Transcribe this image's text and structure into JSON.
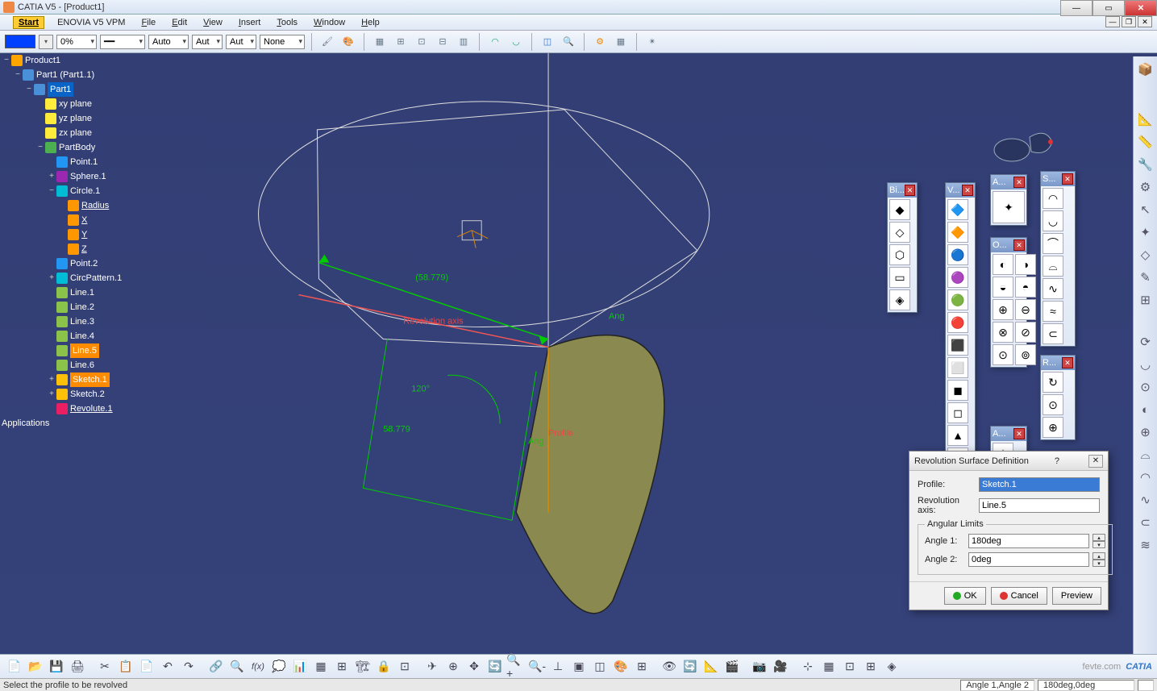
{
  "title": "CATIA V5 - [Product1]",
  "menu": {
    "start": "Start",
    "enovia": "ENOVIA V5 VPM",
    "file": "File",
    "edit": "Edit",
    "view": "View",
    "insert": "Insert",
    "tools": "Tools",
    "window": "Window",
    "help": "Help"
  },
  "optbar": {
    "opacity": "0%",
    "auto1": "Auto",
    "auto2": "Aut",
    "auto3": "Aut",
    "none": "None"
  },
  "tree": {
    "root": "Product1",
    "part_inst": "Part1 (Part1.1)",
    "part": "Part1",
    "planes": [
      "xy plane",
      "yz plane",
      "zx plane"
    ],
    "body": "PartBody",
    "items": [
      "Point.1",
      "Sphere.1",
      "Circle.1"
    ],
    "circle_params": [
      "Radius",
      "X",
      "Y",
      "Z"
    ],
    "items2": [
      "Point.2",
      "CircPattern.1",
      "Line.1",
      "Line.2",
      "Line.3",
      "Line.4"
    ],
    "line5": "Line.5",
    "line6": "Line.6",
    "sketch1": "Sketch.1",
    "sketch2": "Sketch.2",
    "revolute": "Revolute.1",
    "apps": "Applications"
  },
  "geom": {
    "dim1": "(58.779)",
    "angle": "120°",
    "dim2": "58.779",
    "profile_lbl": "Profile",
    "ang1": "Ang",
    "ang2": "Ang",
    "rev_axis": "Revolution axis"
  },
  "palettes": {
    "bi": "Bi...",
    "v": "V...",
    "a1": "A...",
    "o": "O...",
    "a2": "A...",
    "s": "S...",
    "r": "R..."
  },
  "dialog": {
    "title": "Revolution Surface Definition",
    "profile_lbl": "Profile:",
    "profile_val": "Sketch.1",
    "axis_lbl": "Revolution axis:",
    "axis_val": "Line.5",
    "limits_lbl": "Angular Limits",
    "a1_lbl": "Angle 1:",
    "a1_val": "180deg",
    "a2_lbl": "Angle 2:",
    "a2_val": "0deg",
    "ok": "OK",
    "cancel": "Cancel",
    "preview": "Preview"
  },
  "status": {
    "msg": "Select the profile to be revolved",
    "right1": "Angle 1,Angle 2",
    "right2": "180deg,0deg"
  }
}
